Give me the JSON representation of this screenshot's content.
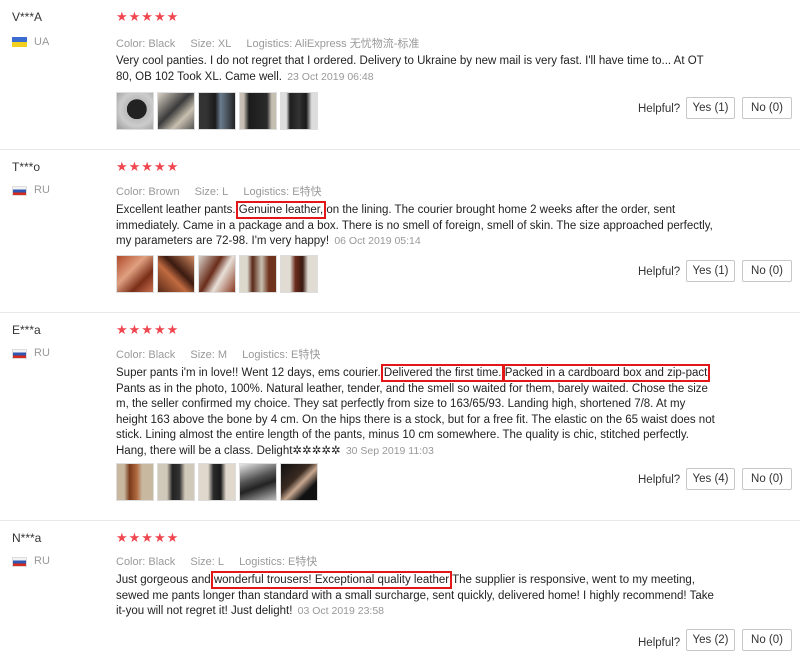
{
  "helpful_label": "Helpful?",
  "reviews": [
    {
      "user": "V***A",
      "country": "UA",
      "stars": "★★★★★",
      "color": "Color: Black",
      "size": "Size: XL",
      "logistics": "Logistics: AliExpress 无忧物流-标准",
      "text": "Very cool panties. I do not regret that I ordered. Delivery to Ukraine by new mail is very fast. I'll have time to... At OT 80, OB 102 Took XL. Came well.",
      "date": "23 Oct 2019 06:48",
      "yes": "Yes (1)",
      "no": "No (0)"
    },
    {
      "user": "T***o",
      "country": "RU",
      "stars": "★★★★★",
      "color": "Color: Brown",
      "size": "Size: L",
      "logistics": "Logistics: E特快",
      "text_a": "Excellent leather pants.",
      "text_hl": "Genuine leather,",
      "text_b": "on the lining. The courier brought home 2 weeks after the order, sent immediately. Came in a package and a box. There is no smell of foreign, smell of skin. The size approached perfectly, my parameters are 72-98. I'm very happy!",
      "date": "06 Oct 2019 05:14",
      "yes": "Yes (1)",
      "no": "No (0)"
    },
    {
      "user": "E***a",
      "country": "RU",
      "stars": "★★★★★",
      "color": "Color: Black",
      "size": "Size: M",
      "logistics": "Logistics: E特快",
      "text_a": "Super pants i'm in love!! Went 12 days, ems courier.",
      "text_hl1": "Delivered the first time.",
      "text_hl2": "Packed in a cardboard box and zip-pact",
      "text_b": "Pants as in the photo, 100%. Natural leather, tender, and the smell so waited for them, barely waited. Chose the size m, the seller confirmed my choice. They sat perfectly from size to 163/65/93. Landing high, shortened 7/8. At my height 163 above the bone by 4 cm. On the hips there is a stock, but for a free fit. The elastic on the 65 waist does not stick. Lining almost the entire length of the pants, minus 10 cm somewhere. The quality is chic, stitched perfectly. Hang, there will be a class. Delight✲✲✲✲✲",
      "date": "30 Sep 2019 11:03",
      "yes": "Yes (4)",
      "no": "No (0)"
    },
    {
      "user": "N***a",
      "country": "RU",
      "stars": "★★★★★",
      "color": "Color: Black",
      "size": "Size: L",
      "logistics": "Logistics: E特快",
      "text_a": "Just gorgeous and",
      "text_hl": "wonderful trousers! Exceptional quality leather",
      "text_b": "The supplier is responsive, went to my meeting, sewed me pants longer than standard with a small surcharge, sent quickly, delivered home! I highly recommend! Take it-you will not regret it! Just delight!",
      "date": "03 Oct 2019 23:58",
      "yes": "Yes (2)",
      "no": "No (0)"
    }
  ]
}
